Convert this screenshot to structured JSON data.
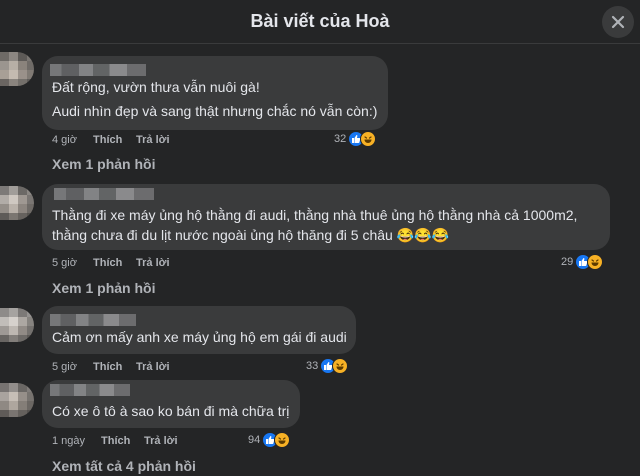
{
  "header": {
    "title": "Bài viết của Hoà",
    "close_icon": "close-icon"
  },
  "comments": [
    {
      "lines": [
        "Đất rộng, vườn thưa vẫn nuôi gà!",
        "Audi nhìn đẹp và sang thật nhưng chắc nó vẫn còn:)"
      ],
      "time": "4 giờ",
      "like_label": "Thích",
      "reply_label": "Trả lời",
      "reaction_count": "32",
      "replies_label": "Xem 1 phản hồi"
    },
    {
      "lines": [
        "Thằng đi xe máy ủng hộ thằng đi audi, thằng nhà thuê ủng hộ thằng nhà cả 1000m2,",
        "thằng chưa đi du lịt nước ngoài ủng hộ thăng đi 5 châu 😂😂😂"
      ],
      "time": "5 giờ",
      "like_label": "Thích",
      "reply_label": "Trả lời",
      "reaction_count": "29",
      "replies_label": "Xem 1 phản hồi"
    },
    {
      "lines": [
        "Cảm ơn mấy anh xe máy ủng hộ em gái đi audi"
      ],
      "time": "5 giờ",
      "like_label": "Thích",
      "reply_label": "Trả lời",
      "reaction_count": "33"
    },
    {
      "lines": [
        "Có xe ô tô à sao ko bán đi mà chữa trị"
      ],
      "time": "1 ngày",
      "like_label": "Thích",
      "reply_label": "Trả lời",
      "reaction_count": "94",
      "replies_label": "Xem tất cả 4 phản hồi"
    }
  ],
  "reaction_icons": [
    "like-icon",
    "haha-icon"
  ],
  "colors": {
    "background": "#242526",
    "bubble": "#3a3b3c",
    "text": "#e4e6eb",
    "muted": "#b0b3b8",
    "like": "#1877f2",
    "haha": "#f7b125"
  }
}
